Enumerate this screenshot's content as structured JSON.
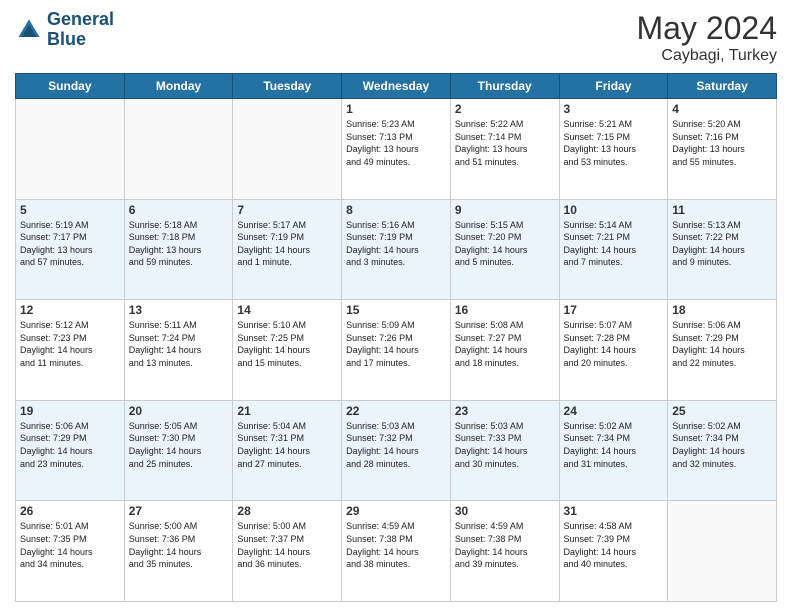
{
  "header": {
    "logo_line1": "General",
    "logo_line2": "Blue",
    "month": "May 2024",
    "location": "Caybagi, Turkey"
  },
  "weekdays": [
    "Sunday",
    "Monday",
    "Tuesday",
    "Wednesday",
    "Thursday",
    "Friday",
    "Saturday"
  ],
  "weeks": [
    [
      {
        "day": "",
        "info": ""
      },
      {
        "day": "",
        "info": ""
      },
      {
        "day": "",
        "info": ""
      },
      {
        "day": "1",
        "info": "Sunrise: 5:23 AM\nSunset: 7:13 PM\nDaylight: 13 hours\nand 49 minutes."
      },
      {
        "day": "2",
        "info": "Sunrise: 5:22 AM\nSunset: 7:14 PM\nDaylight: 13 hours\nand 51 minutes."
      },
      {
        "day": "3",
        "info": "Sunrise: 5:21 AM\nSunset: 7:15 PM\nDaylight: 13 hours\nand 53 minutes."
      },
      {
        "day": "4",
        "info": "Sunrise: 5:20 AM\nSunset: 7:16 PM\nDaylight: 13 hours\nand 55 minutes."
      }
    ],
    [
      {
        "day": "5",
        "info": "Sunrise: 5:19 AM\nSunset: 7:17 PM\nDaylight: 13 hours\nand 57 minutes."
      },
      {
        "day": "6",
        "info": "Sunrise: 5:18 AM\nSunset: 7:18 PM\nDaylight: 13 hours\nand 59 minutes."
      },
      {
        "day": "7",
        "info": "Sunrise: 5:17 AM\nSunset: 7:19 PM\nDaylight: 14 hours\nand 1 minute."
      },
      {
        "day": "8",
        "info": "Sunrise: 5:16 AM\nSunset: 7:19 PM\nDaylight: 14 hours\nand 3 minutes."
      },
      {
        "day": "9",
        "info": "Sunrise: 5:15 AM\nSunset: 7:20 PM\nDaylight: 14 hours\nand 5 minutes."
      },
      {
        "day": "10",
        "info": "Sunrise: 5:14 AM\nSunset: 7:21 PM\nDaylight: 14 hours\nand 7 minutes."
      },
      {
        "day": "11",
        "info": "Sunrise: 5:13 AM\nSunset: 7:22 PM\nDaylight: 14 hours\nand 9 minutes."
      }
    ],
    [
      {
        "day": "12",
        "info": "Sunrise: 5:12 AM\nSunset: 7:23 PM\nDaylight: 14 hours\nand 11 minutes."
      },
      {
        "day": "13",
        "info": "Sunrise: 5:11 AM\nSunset: 7:24 PM\nDaylight: 14 hours\nand 13 minutes."
      },
      {
        "day": "14",
        "info": "Sunrise: 5:10 AM\nSunset: 7:25 PM\nDaylight: 14 hours\nand 15 minutes."
      },
      {
        "day": "15",
        "info": "Sunrise: 5:09 AM\nSunset: 7:26 PM\nDaylight: 14 hours\nand 17 minutes."
      },
      {
        "day": "16",
        "info": "Sunrise: 5:08 AM\nSunset: 7:27 PM\nDaylight: 14 hours\nand 18 minutes."
      },
      {
        "day": "17",
        "info": "Sunrise: 5:07 AM\nSunset: 7:28 PM\nDaylight: 14 hours\nand 20 minutes."
      },
      {
        "day": "18",
        "info": "Sunrise: 5:06 AM\nSunset: 7:29 PM\nDaylight: 14 hours\nand 22 minutes."
      }
    ],
    [
      {
        "day": "19",
        "info": "Sunrise: 5:06 AM\nSunset: 7:29 PM\nDaylight: 14 hours\nand 23 minutes."
      },
      {
        "day": "20",
        "info": "Sunrise: 5:05 AM\nSunset: 7:30 PM\nDaylight: 14 hours\nand 25 minutes."
      },
      {
        "day": "21",
        "info": "Sunrise: 5:04 AM\nSunset: 7:31 PM\nDaylight: 14 hours\nand 27 minutes."
      },
      {
        "day": "22",
        "info": "Sunrise: 5:03 AM\nSunset: 7:32 PM\nDaylight: 14 hours\nand 28 minutes."
      },
      {
        "day": "23",
        "info": "Sunrise: 5:03 AM\nSunset: 7:33 PM\nDaylight: 14 hours\nand 30 minutes."
      },
      {
        "day": "24",
        "info": "Sunrise: 5:02 AM\nSunset: 7:34 PM\nDaylight: 14 hours\nand 31 minutes."
      },
      {
        "day": "25",
        "info": "Sunrise: 5:02 AM\nSunset: 7:34 PM\nDaylight: 14 hours\nand 32 minutes."
      }
    ],
    [
      {
        "day": "26",
        "info": "Sunrise: 5:01 AM\nSunset: 7:35 PM\nDaylight: 14 hours\nand 34 minutes."
      },
      {
        "day": "27",
        "info": "Sunrise: 5:00 AM\nSunset: 7:36 PM\nDaylight: 14 hours\nand 35 minutes."
      },
      {
        "day": "28",
        "info": "Sunrise: 5:00 AM\nSunset: 7:37 PM\nDaylight: 14 hours\nand 36 minutes."
      },
      {
        "day": "29",
        "info": "Sunrise: 4:59 AM\nSunset: 7:38 PM\nDaylight: 14 hours\nand 38 minutes."
      },
      {
        "day": "30",
        "info": "Sunrise: 4:59 AM\nSunset: 7:38 PM\nDaylight: 14 hours\nand 39 minutes."
      },
      {
        "day": "31",
        "info": "Sunrise: 4:58 AM\nSunset: 7:39 PM\nDaylight: 14 hours\nand 40 minutes."
      },
      {
        "day": "",
        "info": ""
      }
    ]
  ]
}
